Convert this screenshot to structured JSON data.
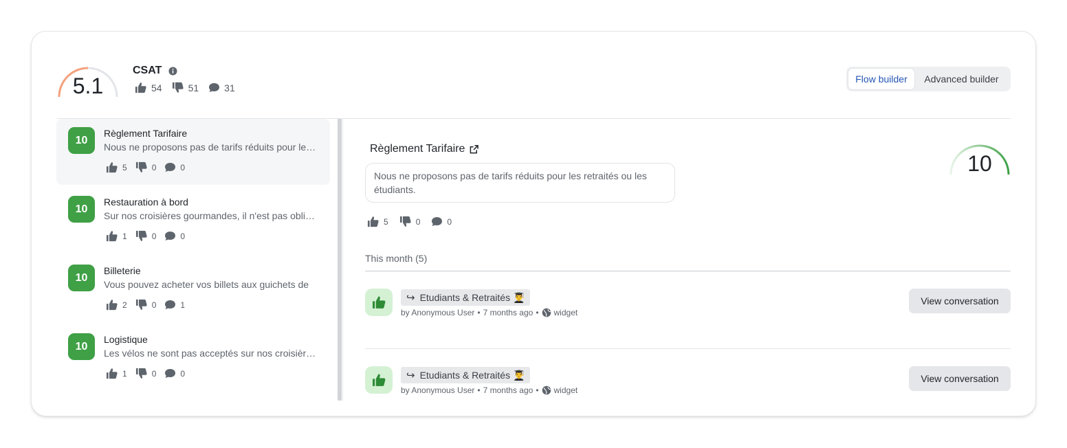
{
  "header": {
    "score": "5.1",
    "score_fraction": 0.51,
    "title": "CSAT",
    "info_icon": "info-icon",
    "likes": "54",
    "dislikes": "51",
    "comments": "31"
  },
  "builder": {
    "flow_label": "Flow builder",
    "advanced_label": "Advanced builder",
    "active": "flow"
  },
  "items": [
    {
      "score": "10",
      "title": "Règlement Tarifaire",
      "desc": "Nous ne proposons pas de tarifs réduits pour les retraités ou les étudiants.",
      "likes": "5",
      "dislikes": "0",
      "comments": "0",
      "selected": true
    },
    {
      "score": "10",
      "title": "Restauration à bord",
      "desc": "Sur nos croisières gourmandes, il n'est pas obligatoire de",
      "likes": "1",
      "dislikes": "0",
      "comments": "0",
      "selected": false
    },
    {
      "score": "10",
      "title": "Billeterie",
      "desc": "Vous pouvez acheter vos billets aux guichets de",
      "likes": "2",
      "dislikes": "0",
      "comments": "1",
      "selected": false
    },
    {
      "score": "10",
      "title": "Logistique",
      "desc": "Les vélos ne sont pas acceptés sur nos croisières.",
      "likes": "1",
      "dislikes": "0",
      "comments": "0",
      "selected": false
    }
  ],
  "detail": {
    "title": "Règlement Tarifaire",
    "answer": "Nous ne proposons pas de tarifs réduits pour les retraités ou les étudiants.",
    "likes": "5",
    "dislikes": "0",
    "comments": "0",
    "score": "10",
    "score_fraction": 1.0,
    "period_label": "This month (5)"
  },
  "conversations": [
    {
      "tag": "Etudiants & Retraités 👨‍🎓",
      "by": "by Anonymous User",
      "when": "7 months ago",
      "channel": "widget",
      "button": "View conversation"
    },
    {
      "tag": "Etudiants & Retraités 👨‍🎓",
      "by": "by Anonymous User",
      "when": "7 months ago",
      "channel": "widget",
      "button": "View conversation"
    }
  ],
  "colors": {
    "accent_blue": "#2456b6",
    "score_green": "#3fa045",
    "gauge_orange": "#f4a27e",
    "like_bg": "#d5f1d4"
  }
}
